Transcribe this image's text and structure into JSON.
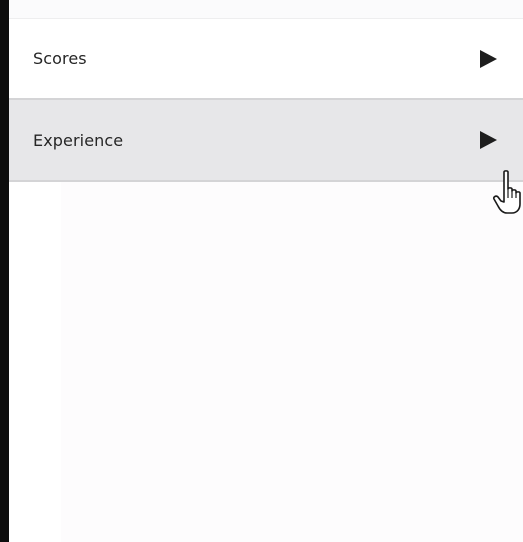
{
  "menu": {
    "items": [
      {
        "label": "Scores",
        "icon": "triangle-right-icon",
        "state": "default"
      },
      {
        "label": "Experience",
        "icon": "triangle-right-icon",
        "state": "hovered"
      }
    ]
  },
  "cursor": {
    "icon": "hand-pointer-cursor-icon"
  },
  "colors": {
    "left_border": "#0d0d0d",
    "item_default_bg": "#ffffff",
    "item_hover_bg": "#e7e7e9",
    "divider": "#d4d4d6",
    "label_text": "#262626",
    "arrow": "#1e1e1e"
  }
}
